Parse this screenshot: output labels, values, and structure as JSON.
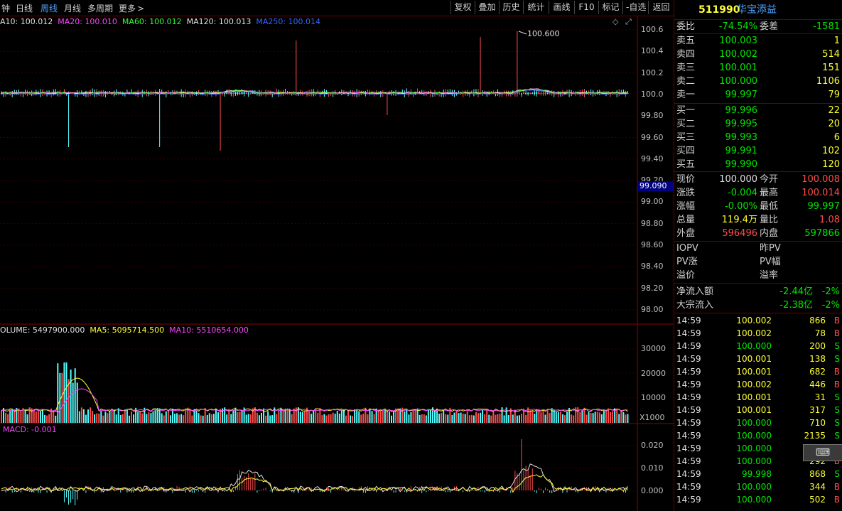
{
  "toolbar": {
    "periods": [
      "钟",
      "日线",
      "周线",
      "月线",
      "多周期",
      "更多"
    ],
    "active_period": "周线",
    "buttons": [
      "复权",
      "叠加",
      "历史",
      "统计",
      "画线",
      "F10",
      "标记",
      "-自选",
      "返回"
    ]
  },
  "price_pane": {
    "legend": [
      {
        "text": "A10: 100.012",
        "color": "#e0e0e0"
      },
      {
        "text": "MA20: 100.010",
        "color": "#ff44ff"
      },
      {
        "text": "MA60: 100.012",
        "color": "#33ff33"
      },
      {
        "text": "MA120: 100.013",
        "color": "#e0e0e0"
      },
      {
        "text": "MA250: 100.014",
        "color": "#3366ff"
      }
    ],
    "yticks": [
      "100.6",
      "100.4",
      "100.2",
      "100.0",
      "99.80",
      "99.60",
      "99.40",
      "99.20",
      "99.00",
      "98.80",
      "98.60",
      "98.40",
      "98.20",
      "98.00"
    ],
    "max_label": "100.600",
    "cursor_price": "99.090"
  },
  "volume_pane": {
    "legend": [
      {
        "text": "OLUME: 5497900.000",
        "color": "#e0e0e0"
      },
      {
        "text": "MA5: 5095714.500",
        "color": "#ffff33"
      },
      {
        "text": "MA10: 5510654.000",
        "color": "#ff44ff"
      }
    ],
    "yticks": [
      "30000",
      "20000",
      "10000"
    ],
    "unit": "X1000"
  },
  "macd_pane": {
    "legend": "MACD: -0.001",
    "yticks": [
      "0.020",
      "0.010",
      "0.000"
    ]
  },
  "quote": {
    "code": "511990",
    "name": "华宝添益",
    "weibi_label": "委比",
    "weibi": "-74.54%",
    "weicha_label": "委差",
    "weicha": "-1581",
    "asks": [
      {
        "label": "卖五",
        "price": "100.003",
        "vol": "1"
      },
      {
        "label": "卖四",
        "price": "100.002",
        "vol": "514"
      },
      {
        "label": "卖三",
        "price": "100.001",
        "vol": "151"
      },
      {
        "label": "卖二",
        "price": "100.000",
        "vol": "1106"
      },
      {
        "label": "卖一",
        "price": "99.997",
        "vol": "79"
      }
    ],
    "bids": [
      {
        "label": "买一",
        "price": "99.996",
        "vol": "22"
      },
      {
        "label": "买二",
        "price": "99.995",
        "vol": "20"
      },
      {
        "label": "买三",
        "price": "99.993",
        "vol": "6"
      },
      {
        "label": "买四",
        "price": "99.991",
        "vol": "102"
      },
      {
        "label": "买五",
        "price": "99.990",
        "vol": "120"
      }
    ],
    "stats": [
      {
        "l1": "现价",
        "v1": "100.000",
        "c1": "white",
        "l2": "今开",
        "v2": "100.008",
        "c2": "red"
      },
      {
        "l1": "涨跌",
        "v1": "-0.004",
        "c1": "green",
        "l2": "最高",
        "v2": "100.014",
        "c2": "red"
      },
      {
        "l1": "涨幅",
        "v1": "-0.00%",
        "c1": "green",
        "l2": "最低",
        "v2": "99.997",
        "c2": "green"
      },
      {
        "l1": "总量",
        "v1": "119.4万",
        "c1": "yellow",
        "l2": "量比",
        "v2": "1.08",
        "c2": "red"
      },
      {
        "l1": "外盘",
        "v1": "596496",
        "c1": "red",
        "l2": "内盘",
        "v2": "597866",
        "c2": "green"
      }
    ],
    "iopv": [
      {
        "l1": "IOPV",
        "l2": "昨PV"
      },
      {
        "l1": "PV涨",
        "l2": "PV幅"
      },
      {
        "l1": "溢价",
        "l2": "溢率"
      }
    ],
    "flows": [
      {
        "label": "净流入额",
        "amount": "-2.44亿",
        "pct": "-2%"
      },
      {
        "label": "大宗流入",
        "amount": "-2.38亿",
        "pct": "-2%"
      }
    ],
    "ticks": [
      {
        "time": "14:59",
        "price": "100.002",
        "vol": "866",
        "side": "B"
      },
      {
        "time": "14:59",
        "price": "100.002",
        "vol": "78",
        "side": "B"
      },
      {
        "time": "14:59",
        "price": "100.000",
        "vol": "200",
        "side": "S"
      },
      {
        "time": "14:59",
        "price": "100.001",
        "vol": "138",
        "side": "S"
      },
      {
        "time": "14:59",
        "price": "100.001",
        "vol": "682",
        "side": "B"
      },
      {
        "time": "14:59",
        "price": "100.002",
        "vol": "446",
        "side": "B"
      },
      {
        "time": "14:59",
        "price": "100.001",
        "vol": "31",
        "side": "S"
      },
      {
        "time": "14:59",
        "price": "100.001",
        "vol": "317",
        "side": "S"
      },
      {
        "time": "14:59",
        "price": "100.000",
        "vol": "710",
        "side": "S"
      },
      {
        "time": "14:59",
        "price": "100.000",
        "vol": "2135",
        "side": "S"
      },
      {
        "time": "14:59",
        "price": "100.000",
        "vol": "",
        "side": ""
      },
      {
        "time": "14:59",
        "price": "100.000",
        "vol": "292",
        "side": "B"
      },
      {
        "time": "14:59",
        "price": "99.998",
        "vol": "868",
        "side": "S"
      },
      {
        "time": "14:59",
        "price": "100.000",
        "vol": "344",
        "side": "B"
      },
      {
        "time": "14:59",
        "price": "100.000",
        "vol": "502",
        "side": "B"
      }
    ]
  }
}
